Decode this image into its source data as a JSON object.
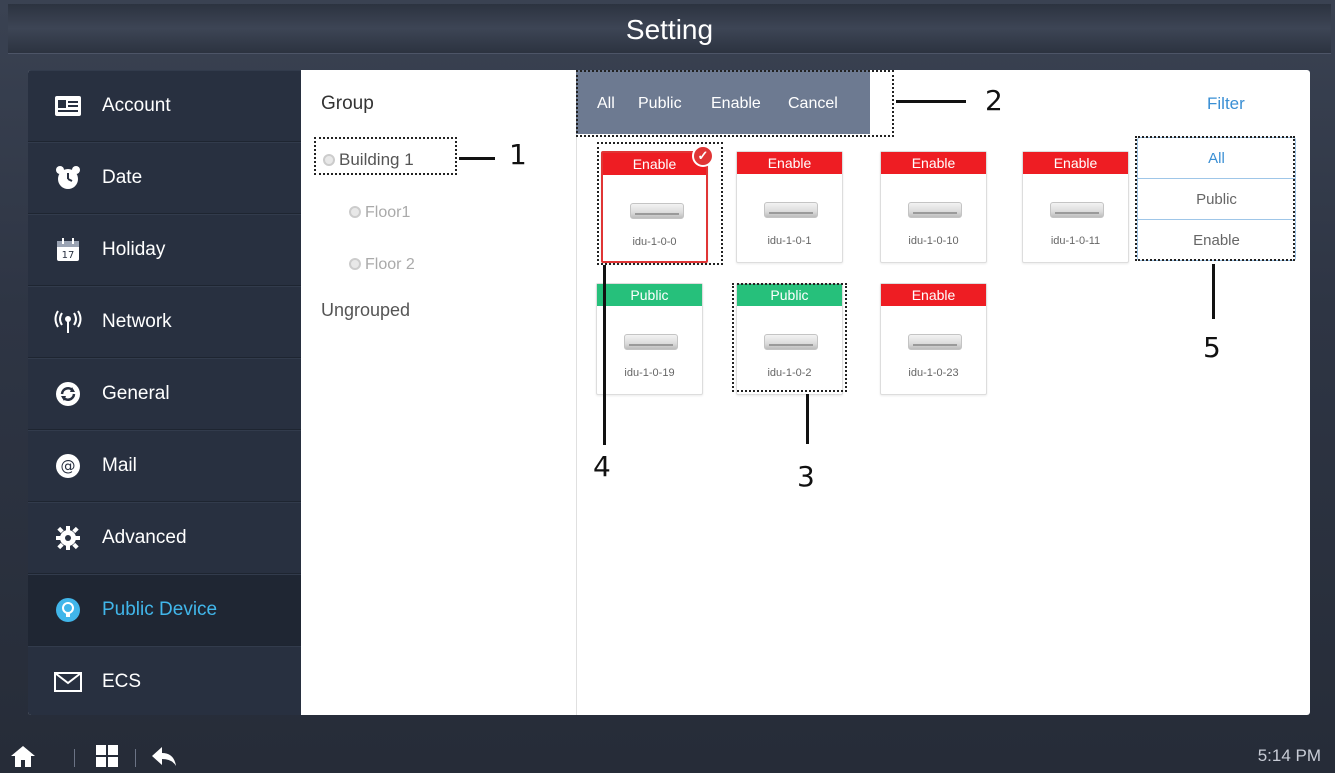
{
  "window": {
    "title": "Setting"
  },
  "sidebar": {
    "items": [
      {
        "label": "Account",
        "icon": "account-card-icon",
        "active": false
      },
      {
        "label": "Date",
        "icon": "alarm-clock-icon",
        "active": false
      },
      {
        "label": "Holiday",
        "icon": "calendar-icon",
        "active": false
      },
      {
        "label": "Network",
        "icon": "wireless-antenna-icon",
        "active": false
      },
      {
        "label": "General",
        "icon": "refresh-icon",
        "active": false
      },
      {
        "label": "Mail",
        "icon": "at-sign-icon",
        "active": false
      },
      {
        "label": "Advanced",
        "icon": "gear-icon",
        "active": false
      },
      {
        "label": "Public Device",
        "icon": "device-icon",
        "active": true
      },
      {
        "label": "ECS",
        "icon": "envelope-icon",
        "active": false
      }
    ]
  },
  "groups": {
    "header": "Group",
    "tree": [
      {
        "label": "Building 1"
      },
      {
        "label": "Floor1"
      },
      {
        "label": "Floor 2"
      }
    ],
    "ungrouped": "Ungrouped"
  },
  "toolbar": {
    "all": "All",
    "public": "Public",
    "enable": "Enable",
    "cancel": "Cancel"
  },
  "filter": {
    "label": "Filter",
    "options": [
      "All",
      "Public",
      "Enable"
    ]
  },
  "devices": [
    {
      "status": "Enable",
      "name": "idu-1-0-0",
      "selected": true
    },
    {
      "status": "Enable",
      "name": "idu-1-0-1",
      "selected": false
    },
    {
      "status": "Enable",
      "name": "idu-1-0-10",
      "selected": false
    },
    {
      "status": "Enable",
      "name": "idu-1-0-11",
      "selected": false
    },
    {
      "status": "Public",
      "name": "idu-1-0-19",
      "selected": false
    },
    {
      "status": "Public",
      "name": "idu-1-0-2",
      "selected": false
    },
    {
      "status": "Enable",
      "name": "idu-1-0-23",
      "selected": false
    }
  ],
  "annotations": {
    "a1": "1",
    "a2": "2",
    "a3": "3",
    "a4": "4",
    "a5": "5"
  },
  "statusbar": {
    "time": "5:14 PM"
  },
  "colors": {
    "enable": "#ee1d23",
    "public": "#26c07b",
    "accent": "#41b6ea",
    "toolbar": "#6d7a91"
  }
}
